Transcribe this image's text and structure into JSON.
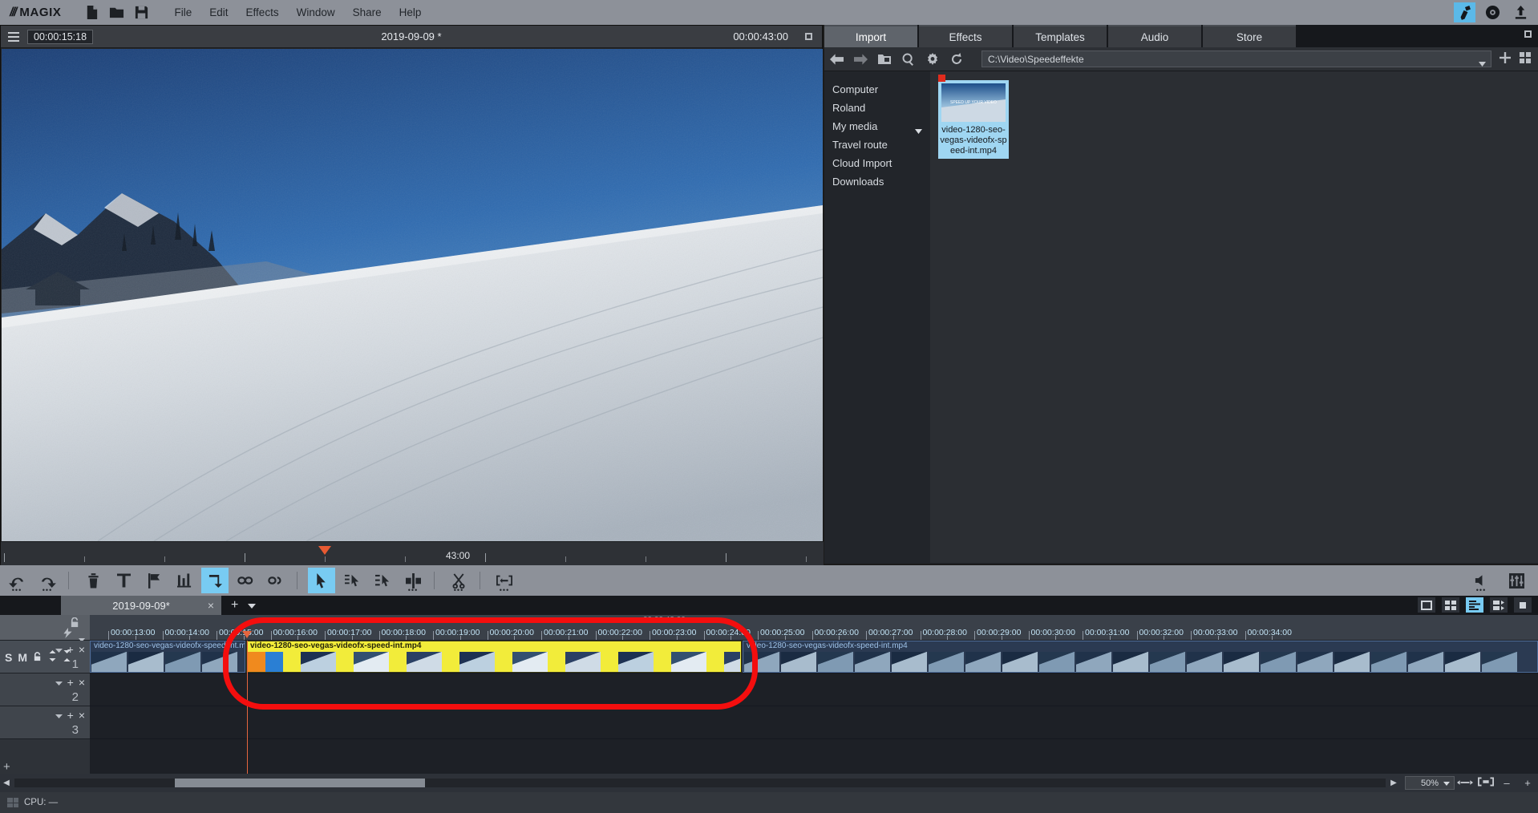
{
  "app": {
    "brand": "MAGIX",
    "brand_slashes": "///"
  },
  "menubar": {
    "icons": [
      {
        "name": "new-project-icon",
        "glyph": "page"
      },
      {
        "name": "open-project-icon",
        "glyph": "folder"
      },
      {
        "name": "save-project-icon",
        "glyph": "floppy"
      }
    ],
    "menus": [
      "File",
      "Edit",
      "Effects",
      "Window",
      "Share",
      "Help"
    ],
    "right_buttons": [
      {
        "name": "edit-mode-button",
        "selected": true
      },
      {
        "name": "burn-mode-button",
        "selected": false
      },
      {
        "name": "export-mode-button",
        "selected": false
      }
    ]
  },
  "preview": {
    "timecode_left": "00:00:15:18",
    "title": "2019-09-09 *",
    "timecode_right": "00:00:43:00",
    "scrub_label": "43:00",
    "scrub_head_percent": 30,
    "transport": [
      {
        "name": "set-in-point-button",
        "label": "["
      },
      {
        "name": "set-out-point-button",
        "label": "]"
      },
      {
        "name": "jump-to-start-button",
        "label": "[←"
      },
      {
        "name": "previous-frame-button",
        "label": "▌◀"
      },
      {
        "name": "play-button",
        "label": "▶"
      },
      {
        "name": "next-frame-button",
        "label": "[▶]"
      },
      {
        "name": "jump-to-end-button",
        "label": "→]"
      },
      {
        "name": "record-button",
        "label": ""
      }
    ]
  },
  "pool": {
    "tabs": [
      {
        "label": "Import",
        "active": true
      },
      {
        "label": "Effects",
        "active": false
      },
      {
        "label": "Templates",
        "active": false
      },
      {
        "label": "Audio",
        "active": false
      },
      {
        "label": "Store",
        "active": false
      }
    ],
    "toolbar_icons": [
      "back-arrow-icon",
      "forward-arrow-icon",
      "up-folder-icon",
      "search-icon",
      "gear-icon",
      "refresh-icon"
    ],
    "path": "C:\\Video\\Speedeffekte",
    "view_buttons": [
      "add-media-icon",
      "grid-view-icon"
    ],
    "tree": [
      {
        "label": "Computer",
        "caret": false
      },
      {
        "label": "Roland",
        "caret": false
      },
      {
        "label": "My media",
        "caret": true
      },
      {
        "label": "Travel route",
        "caret": false
      },
      {
        "label": "Cloud Import",
        "caret": false
      },
      {
        "label": "Downloads",
        "caret": false
      }
    ],
    "files": [
      {
        "name": "video-1280-seo-vegas-videofx-speed-int.mp4",
        "selected": true,
        "flagged": true,
        "thumb_text": "SPEED UP YOUR VIDEO"
      }
    ]
  },
  "edit_toolbar": {
    "tools": [
      {
        "name": "undo-button",
        "selected": false,
        "dots": true
      },
      {
        "name": "redo-button",
        "selected": false,
        "dots": true
      },
      {
        "name": "delete-object-button",
        "selected": false,
        "dots": false
      },
      {
        "name": "title-text-button",
        "selected": false,
        "dots": false
      },
      {
        "name": "marker-flag-button",
        "selected": false,
        "dots": false
      },
      {
        "name": "audio-mix-button",
        "selected": false,
        "dots": false
      },
      {
        "name": "loop-button",
        "selected": true,
        "dots": false
      },
      {
        "name": "link-objects-button",
        "selected": false,
        "dots": false
      },
      {
        "name": "unlink-objects-button",
        "selected": false,
        "dots": false
      },
      {
        "name": "mouse-mode-arrow-button",
        "selected": true,
        "dots": false
      },
      {
        "name": "single-object-mode-button",
        "selected": false,
        "dots": false
      },
      {
        "name": "all-tracks-mode-button",
        "selected": false,
        "dots": false
      },
      {
        "name": "curve-mode-button",
        "selected": false,
        "dots": true
      },
      {
        "name": "cut-scissors-button",
        "selected": false,
        "dots": true
      },
      {
        "name": "trim-range-button",
        "selected": false,
        "dots": true
      }
    ],
    "right_tools": [
      {
        "name": "speaker-volume-button",
        "dots": true
      },
      {
        "name": "audio-mixer-button",
        "dots": false
      }
    ]
  },
  "timeline": {
    "tab": {
      "label": "2019-09-09*",
      "close": "×",
      "add": "+",
      "caret": "▾"
    },
    "view_buttons": [
      {
        "name": "storyboard-view-button",
        "selected": false
      },
      {
        "name": "scene-overview-button",
        "selected": false
      },
      {
        "name": "timeline-view-button",
        "selected": true
      },
      {
        "name": "multicam-view-button",
        "selected": false
      },
      {
        "name": "maximize-timeline-button",
        "selected": false
      }
    ],
    "project_end_timecode": "00:00:43:00",
    "ruler_labels": [
      "00:00:13:00",
      "00:00:14:00",
      "00:00:15:00",
      "00:00:16:00",
      "00:00:17:00",
      "00:00:18:00",
      "00:00:19:00",
      "00:00:20:00",
      "00:00:21:00",
      "00:00:22:00",
      "00:00:23:00",
      "00:00:24:00",
      "00:00:25:00",
      "00:00:26:00",
      "00:00:27:00",
      "00:00:28:00",
      "00:00:29:00",
      "00:00:30:00",
      "00:00:31:00",
      "00:00:32:00",
      "00:00:33:00",
      "00:00:34:00"
    ],
    "playhead_label": "00:00:15:18",
    "tracks": [
      {
        "number": "1",
        "solo": "S",
        "mute": "M",
        "lock_icon": "lock-icon",
        "clips": [
          {
            "name": "video-1280-seo-vegas-videofx-speed-int.mp4",
            "color": "blue",
            "selected": false
          },
          {
            "name": "video-1280-seo-vegas-videofx-speed-int.mp4",
            "color": "yellow",
            "selected": true
          },
          {
            "name": "video-1280-seo-vegas-videofx-speed-int.mp4",
            "color": "blue",
            "selected": false
          }
        ]
      },
      {
        "number": "2",
        "clips": []
      },
      {
        "number": "3",
        "clips": []
      }
    ],
    "add_track_label": "+",
    "zoom_level": "50%",
    "zoom_buttons": [
      "fit-range-icon",
      "fit-project-icon",
      "zoom-out",
      "zoom-in"
    ],
    "zoom_out_label": "–",
    "zoom_in_label": "+"
  },
  "statusbar": {
    "cpu_label": "CPU: —"
  },
  "colors": {
    "accent_blue": "#78cbf2",
    "selected_clip": "#f2ec3a",
    "annotation_red": "#f40e0e",
    "record_red": "#e0513a",
    "playhead": "#e4653e"
  }
}
